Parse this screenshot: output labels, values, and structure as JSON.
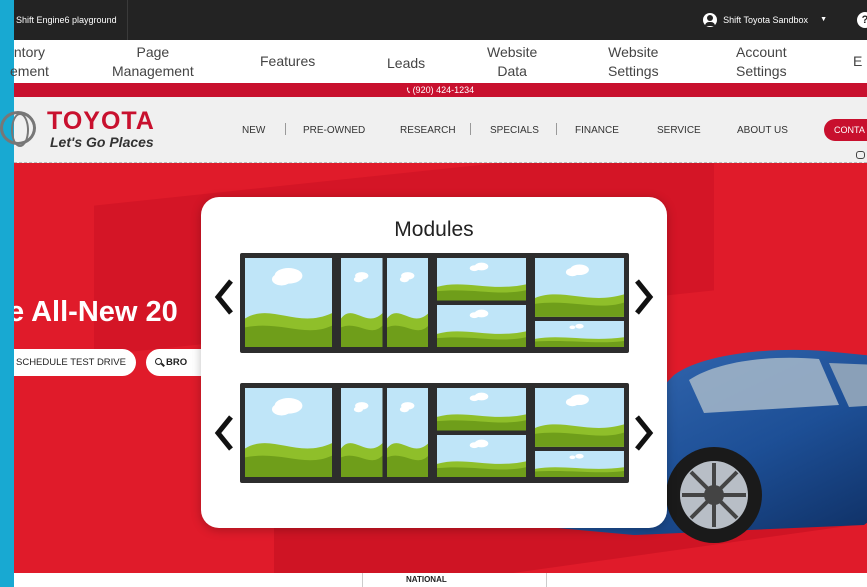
{
  "app": {
    "name": "Shift Engine6 playground",
    "account": "Shift Toyota Sandbox",
    "help": "?"
  },
  "nav": [
    {
      "label": "ntory\nement"
    },
    {
      "label": "Page\nManagement"
    },
    {
      "label": "Features"
    },
    {
      "label": "Leads"
    },
    {
      "label": "Website\nData"
    },
    {
      "label": "Website\nSettings"
    },
    {
      "label": "Account\nSettings"
    },
    {
      "label": "E"
    }
  ],
  "dealer": {
    "phone": "(920) 424-1234",
    "brand": "TOYOTA",
    "slogan": "Let's Go Places",
    "menu": [
      "NEW",
      "PRE-OWNED",
      "RESEARCH",
      "SPECIALS",
      "FINANCE",
      "SERVICE",
      "ABOUT US"
    ],
    "contact": "CONTA"
  },
  "hero": {
    "headline": "e All-New 20",
    "test_drive": "SCHEDULE TEST DRIVE",
    "browse": "BRO"
  },
  "footer": {
    "national": "NATIONAL"
  },
  "modules": {
    "title": "Modules",
    "rows": [
      {
        "layouts": [
          "full-width",
          "two-column",
          "two-row",
          "two-row-large-top"
        ]
      },
      {
        "layouts": [
          "full-width",
          "two-column",
          "two-row",
          "two-row-large-top"
        ]
      }
    ]
  },
  "colors": {
    "toyota_red": "#c8102e",
    "hero_red": "#e01b2a",
    "top_bar": "#232323",
    "frame_blue": "#1aa6cf",
    "sky": "#bfe5f8",
    "grass": "#8fbf2a"
  },
  "icons": [
    "phone-icon",
    "user-icon",
    "caret-down-icon",
    "help-icon",
    "search-icon",
    "chat-icon",
    "chevron-left-icon",
    "chevron-right-icon"
  ]
}
